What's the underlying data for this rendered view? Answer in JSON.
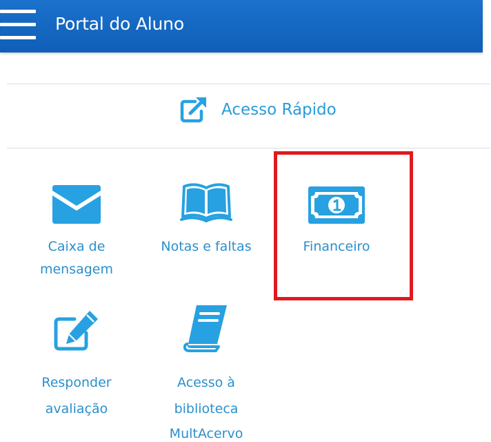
{
  "header": {
    "title": "Portal do Aluno",
    "menu_icon": "hamburger-menu-icon",
    "background_color": "#0f5fb7"
  },
  "quick_access": {
    "label": "Acesso Rápido",
    "icon": "external-link-icon"
  },
  "tiles": [
    {
      "icon": "envelope-icon",
      "label_lines": [
        "Caixa de",
        "mensagem"
      ]
    },
    {
      "icon": "open-book-icon",
      "label_lines": [
        "Notas e faltas"
      ]
    },
    {
      "icon": "banknote-icon",
      "label_lines": [
        "Financeiro"
      ],
      "highlighted": true
    },
    {
      "icon": "edit-icon",
      "label_lines": [
        "Responder",
        "avaliação"
      ]
    },
    {
      "icon": "library-book-icon",
      "label_lines": [
        "Acesso à",
        "biblioteca",
        "MultAcervo"
      ]
    }
  ],
  "colors": {
    "accent": "#2a9bd8",
    "icon": "#27a1e1",
    "highlight_border": "#e0191f",
    "divider": "#d5dde4"
  }
}
